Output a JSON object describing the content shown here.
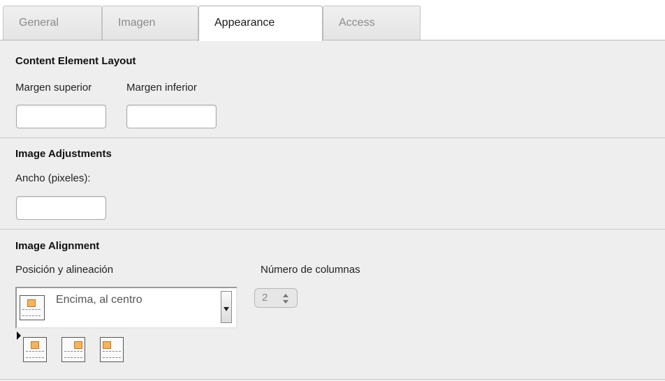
{
  "tabs": [
    {
      "label": "General",
      "active": false
    },
    {
      "label": "Imagen",
      "active": false
    },
    {
      "label": "Appearance",
      "active": true
    },
    {
      "label": "Access",
      "active": false
    }
  ],
  "content_layout": {
    "title": "Content Element Layout",
    "margin_top_label": "Margen superior",
    "margin_top_value": "",
    "margin_bottom_label": "Margen inferior",
    "margin_bottom_value": ""
  },
  "image_adjustments": {
    "title": "Image Adjustments",
    "width_label": "Ancho (pixeles):",
    "width_value": ""
  },
  "image_alignment": {
    "title": "Image Alignment",
    "position_label": "Posición y alineación",
    "position_selected": "Encima, al centro",
    "columns_label": "Número de columnas",
    "columns_value": "2",
    "position_thumbnails": [
      "above-center-icon",
      "above-right-icon",
      "above-left-icon"
    ]
  },
  "colors": {
    "panel_bg": "#eeeeee",
    "image_accent": "#f6b25c"
  }
}
